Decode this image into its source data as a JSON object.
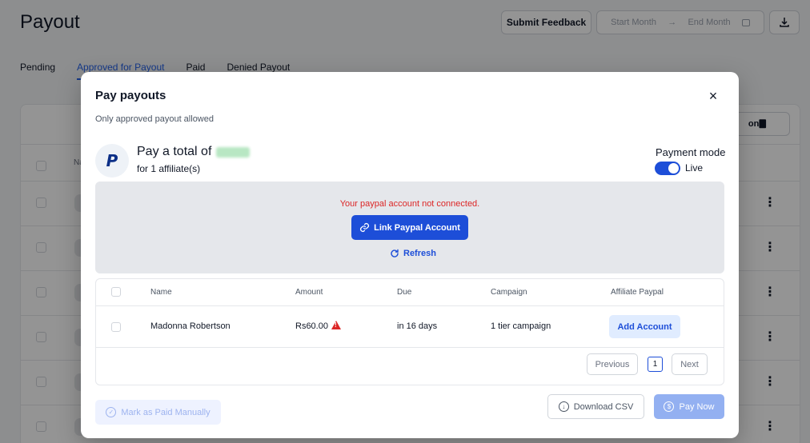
{
  "page": {
    "title": "Payout",
    "submit_feedback": "Submit Feedback",
    "date_start_placeholder": "Start Month",
    "date_arrow": "→",
    "date_end_placeholder": "End Month",
    "tabs": [
      "Pending",
      "Approved for Payout",
      "Paid",
      "Denied Payout"
    ],
    "active_tab_index": 1,
    "table_header_partial": "Na",
    "toolbar_partial": "on🀫",
    "kebab": "⋮"
  },
  "modal": {
    "title": "Pay payouts",
    "close": "×",
    "subtitle": "Only approved payout allowed",
    "paypal_letter": "P",
    "total_prefix": "Pay a total of",
    "total_sub": "for 1 affiliate(s)",
    "payment_mode_label": "Payment mode",
    "payment_mode_value": "Live",
    "payment_mode_on": true,
    "alert_text": "Your paypal account not connected.",
    "link_button": "Link Paypal Account",
    "refresh_button": "Refresh",
    "table": {
      "headers": [
        "Name",
        "Amount",
        "Due",
        "Campaign",
        "Affiliate Paypal"
      ],
      "rows": [
        {
          "name": "Madonna Robertson",
          "amount": "Rs60.00",
          "due": "in 16 days",
          "campaign": "1 tier campaign",
          "action": "Add Account"
        }
      ],
      "pagination": {
        "previous": "Previous",
        "page": "1",
        "next": "Next"
      }
    },
    "mark_paid": "Mark as Paid Manually",
    "download_csv": "Download CSV",
    "pay_now": "Pay Now"
  },
  "colors": {
    "primary": "#1d4ed8",
    "danger": "#dc2626",
    "muted_primary": "#93b0f1"
  }
}
